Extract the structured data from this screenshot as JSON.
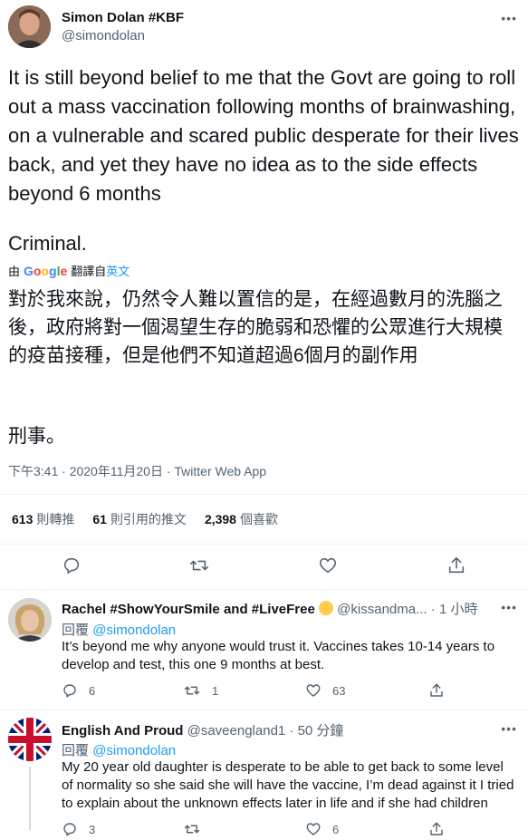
{
  "main_tweet": {
    "author_name": "Simon Dolan #KBF",
    "author_handle": "@simondolan",
    "text": "It is still beyond belief to me that the Govt are going to roll out a mass vaccination following months of brainwashing, on a vulnerable and scared public desperate for their lives back, and yet they have no idea as to the side effects beyond 6 months",
    "text_criminal": "Criminal.",
    "translate_prefix": "由",
    "translate_provider": "Google",
    "translate_from": "翻譯自",
    "translate_lang": "英文",
    "translated_text": "對於我來說，仍然令人難以置信的是，在經過數月的洗腦之後，政府將對一個渴望生存的脆弱和恐懼的公眾進行大規模的疫苗接種，但是他們不知道超過6個月的副作用",
    "translated_criminal": "刑事。",
    "timestamp": "下午3:41 · 2020年11月20日 · Twitter Web App",
    "retweets_count": "613",
    "retweets_label": "則轉推",
    "quotes_count": "61",
    "quotes_label": "則引用的推文",
    "likes_count": "2,398",
    "likes_label": "個喜歡"
  },
  "replies": [
    {
      "author_name": "Rachel #ShowYourSmile and #LiveFree",
      "author_handle": "@kissandma...",
      "time": "· 1 小時",
      "reply_to_label": "回覆",
      "reply_to_handle": "@simondolan",
      "text": "It’s beyond me why anyone would trust it. Vaccines takes 10-14 years to develop and test, this one 9 months at best.",
      "reply_count": "6",
      "retweet_count": "1",
      "like_count": "63"
    },
    {
      "author_name": "English And Proud",
      "author_handle": "@saveengland1",
      "time": "· 50 分鐘",
      "reply_to_label": "回覆",
      "reply_to_handle": "@simondolan",
      "text": "My 20 year old daughter is desperate to be able to get back to some level of normality so she said she will have the vaccine, I’m dead against it I tried to explain about the unknown effects later in life and if she had children",
      "reply_count": "3",
      "retweet_count": "",
      "like_count": "6"
    }
  ],
  "icons": {
    "more": "more-horizontal-icon",
    "reply": "reply-icon",
    "retweet": "retweet-icon",
    "like": "heart-icon",
    "share": "share-icon"
  },
  "colors": {
    "link": "#1d9bf0",
    "secondary_text": "#536471",
    "divider": "#eff3f4"
  }
}
